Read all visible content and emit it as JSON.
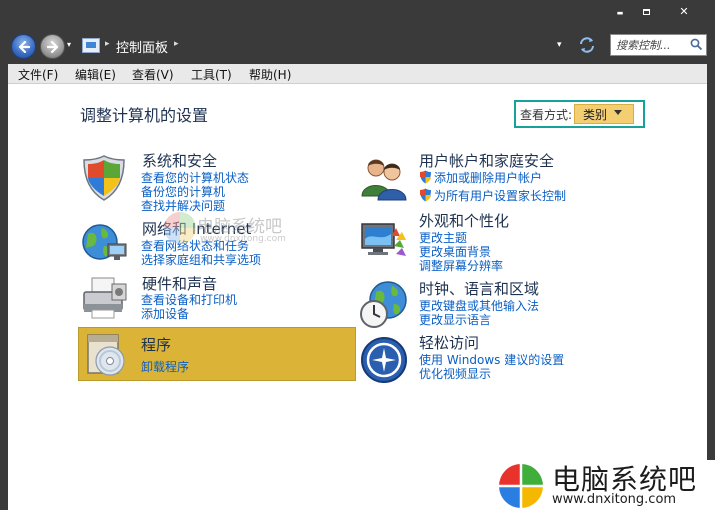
{
  "window": {
    "minimize_glyph": "▬",
    "close_glyph": "✕"
  },
  "address_bar": {
    "breadcrumb": "控制面板",
    "separator": "▸",
    "dropdown_glyph": "▾",
    "search_placeholder": "搜索控制..."
  },
  "menu": {
    "file": "文件(F)",
    "edit": "编辑(E)",
    "view": "查看(V)",
    "tools": "工具(T)",
    "help": "帮助(H)"
  },
  "page": {
    "title": "调整计算机的设置",
    "view_by_label": "查看方式:",
    "view_by_value": "类别"
  },
  "categories": [
    {
      "title": "系统和安全",
      "icon": "shield-icon",
      "links": [
        "查看您的计算机状态",
        "备份您的计算机",
        "查找并解决问题"
      ]
    },
    {
      "title": "网络和 Internet",
      "icon": "network-globe-icon",
      "links": [
        "查看网络状态和任务",
        "选择家庭组和共享选项"
      ]
    },
    {
      "title": "硬件和声音",
      "icon": "printer-icon",
      "links": [
        "查看设备和打印机",
        "添加设备"
      ]
    },
    {
      "title": "程序",
      "icon": "programs-disc-icon",
      "links": [
        "卸载程序"
      ]
    },
    {
      "title": "用户帐户和家庭安全",
      "icon": "users-icon",
      "links": [
        "添加或删除用户帐户",
        "为所有用户设置家长控制"
      ]
    },
    {
      "title": "外观和个性化",
      "icon": "monitor-palette-icon",
      "links": [
        "更改主题",
        "更改桌面背景",
        "调整屏幕分辨率"
      ]
    },
    {
      "title": "时钟、语言和区域",
      "icon": "globe-clock-icon",
      "links": [
        "更改键盘或其他输入法",
        "更改显示语言"
      ]
    },
    {
      "title": "轻松访问",
      "icon": "accessibility-icon",
      "links": [
        "使用 Windows 建议的设置",
        "优化视频显示"
      ]
    }
  ],
  "watermark": {
    "brand": "电脑系统吧",
    "url": "www.dnxitong.com",
    "url_faint": "www.dnxitong.com",
    "brand_faint": "电脑系统吧"
  },
  "colors": {
    "chrome": "#3a3a3a",
    "link": "#0a5fc5",
    "highlight": "#dbb437",
    "view_by_border": "#18a198",
    "view_by_fill": "#f4cf72"
  }
}
